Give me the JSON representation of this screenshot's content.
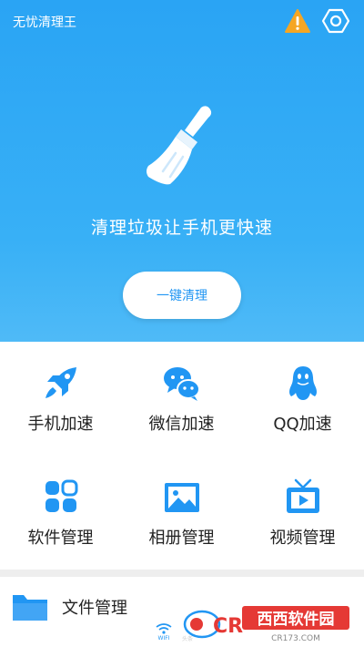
{
  "header": {
    "app_title": "无忧清理王",
    "warning_icon": "warning-icon",
    "settings_icon": "hexagon-settings-icon"
  },
  "hero": {
    "message": "清理垃圾让手机更快速",
    "clean_button_label": "一键清理",
    "broom_icon": "broom-icon"
  },
  "features": [
    {
      "label": "手机加速",
      "icon": "rocket-icon"
    },
    {
      "label": "微信加速",
      "icon": "wechat-icon"
    },
    {
      "label": "QQ加速",
      "icon": "qq-penguin-icon"
    },
    {
      "label": "软件管理",
      "icon": "apps-icon"
    },
    {
      "label": "相册管理",
      "icon": "photo-album-icon"
    },
    {
      "label": "视频管理",
      "icon": "tv-video-icon"
    }
  ],
  "files": {
    "label": "文件管理",
    "icon": "folder-icon"
  },
  "bottom_tabs": {
    "wifi_label": "WIFI",
    "second_label": "头条"
  },
  "watermark": {
    "brand": "西西软件园",
    "domain": "CR173.COM"
  },
  "colors": {
    "accent": "#2196f3",
    "hero_top": "#2aa4f4",
    "hero_bottom": "#4fbaf7",
    "warning": "#f5a623",
    "text": "#222222"
  }
}
